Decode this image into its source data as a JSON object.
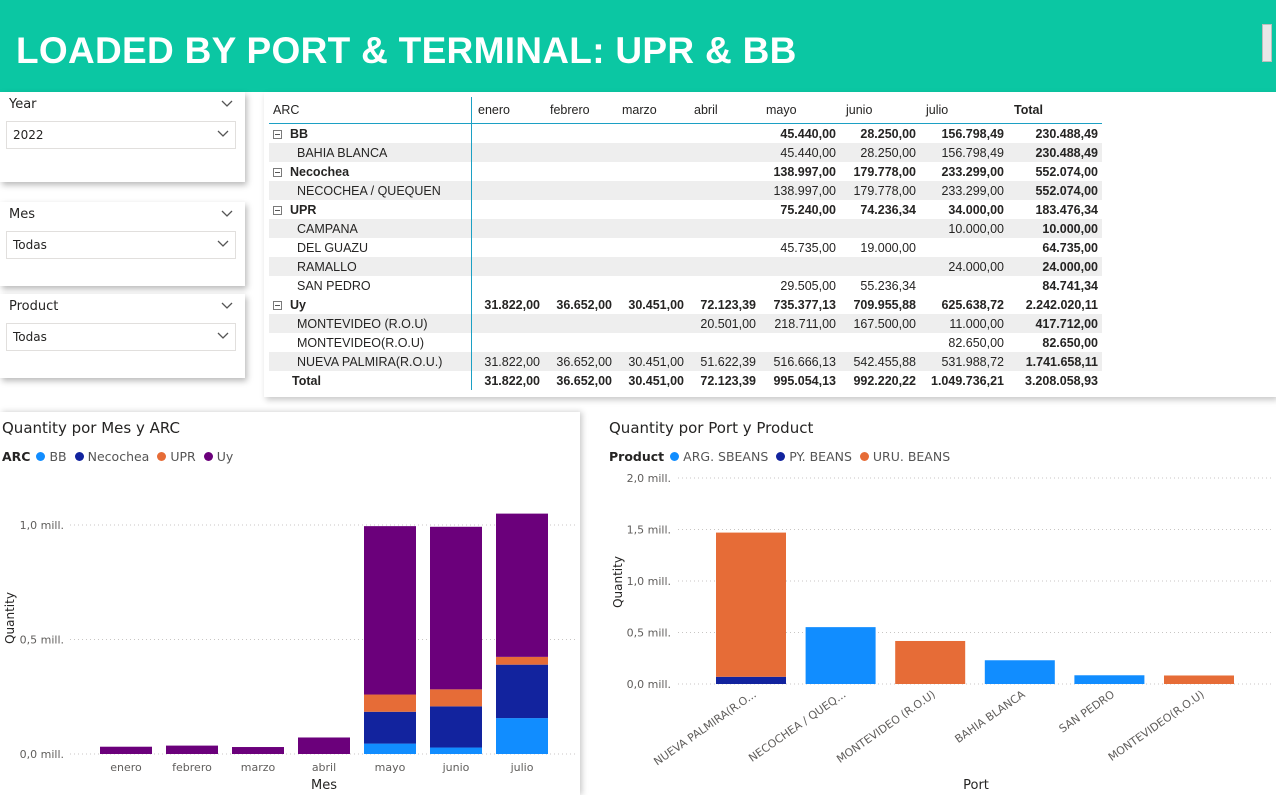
{
  "header": {
    "title": "LOADED BY PORT & TERMINAL: UPR & BB"
  },
  "slicers": {
    "year": {
      "label": "Year",
      "value": "2022"
    },
    "mes": {
      "label": "Mes",
      "value": "Todas"
    },
    "product": {
      "label": "Product",
      "value": "Todas"
    }
  },
  "matrix": {
    "columns": [
      "ARC",
      "enero",
      "febrero",
      "marzo",
      "abril",
      "mayo",
      "junio",
      "julio",
      "Total"
    ],
    "rows": [
      {
        "type": "group",
        "label": "BB",
        "values": [
          "",
          "",
          "",
          "",
          "45.440,00",
          "28.250,00",
          "156.798,49",
          "230.488,49"
        ]
      },
      {
        "type": "detail",
        "label": "BAHIA BLANCA",
        "values": [
          "",
          "",
          "",
          "",
          "45.440,00",
          "28.250,00",
          "156.798,49",
          "230.488,49"
        ]
      },
      {
        "type": "group",
        "label": "Necochea",
        "values": [
          "",
          "",
          "",
          "",
          "138.997,00",
          "179.778,00",
          "233.299,00",
          "552.074,00"
        ]
      },
      {
        "type": "detail",
        "label": "NECOCHEA / QUEQUEN",
        "values": [
          "",
          "",
          "",
          "",
          "138.997,00",
          "179.778,00",
          "233.299,00",
          "552.074,00"
        ]
      },
      {
        "type": "group",
        "label": "UPR",
        "values": [
          "",
          "",
          "",
          "",
          "75.240,00",
          "74.236,34",
          "34.000,00",
          "183.476,34"
        ]
      },
      {
        "type": "detail",
        "label": "CAMPANA",
        "values": [
          "",
          "",
          "",
          "",
          "",
          "",
          "10.000,00",
          "10.000,00"
        ]
      },
      {
        "type": "detail",
        "label": "DEL GUAZU",
        "values": [
          "",
          "",
          "",
          "",
          "45.735,00",
          "19.000,00",
          "",
          "64.735,00"
        ]
      },
      {
        "type": "detail",
        "label": "RAMALLO",
        "values": [
          "",
          "",
          "",
          "",
          "",
          "",
          "24.000,00",
          "24.000,00"
        ]
      },
      {
        "type": "detail",
        "label": "SAN PEDRO",
        "values": [
          "",
          "",
          "",
          "",
          "29.505,00",
          "55.236,34",
          "",
          "84.741,34"
        ]
      },
      {
        "type": "group",
        "label": "Uy",
        "values": [
          "31.822,00",
          "36.652,00",
          "30.451,00",
          "72.123,39",
          "735.377,13",
          "709.955,88",
          "625.638,72",
          "2.242.020,11"
        ]
      },
      {
        "type": "detail",
        "label": "MONTEVIDEO (R.O.U)",
        "values": [
          "",
          "",
          "",
          "20.501,00",
          "218.711,00",
          "167.500,00",
          "11.000,00",
          "417.712,00"
        ]
      },
      {
        "type": "detail",
        "label": "MONTEVIDEO(R.O.U)",
        "values": [
          "",
          "",
          "",
          "",
          "",
          "",
          "82.650,00",
          "82.650,00"
        ]
      },
      {
        "type": "detail",
        "label": "NUEVA PALMIRA(R.O.U.)",
        "values": [
          "31.822,00",
          "36.652,00",
          "30.451,00",
          "51.622,39",
          "516.666,13",
          "542.455,88",
          "531.988,72",
          "1.741.658,11"
        ]
      },
      {
        "type": "total",
        "label": "Total",
        "values": [
          "31.822,00",
          "36.652,00",
          "30.451,00",
          "72.123,39",
          "995.054,13",
          "992.220,22",
          "1.049.736,21",
          "3.208.058,93"
        ]
      }
    ]
  },
  "chart_data": [
    {
      "type": "bar",
      "stacked": true,
      "title": "Quantity por Mes y ARC",
      "legend_title": "ARC",
      "legend_position": "top-left",
      "xlabel": "Mes",
      "ylabel": "Quantity",
      "categories": [
        "enero",
        "febrero",
        "marzo",
        "abril",
        "mayo",
        "junio",
        "julio"
      ],
      "yticks": [
        {
          "value": 0,
          "label": "0,0 mill."
        },
        {
          "value": 500000,
          "label": "0,5 mill."
        },
        {
          "value": 1000000,
          "label": "1,0 mill."
        }
      ],
      "ylim": [
        0,
        1150000
      ],
      "grid": true,
      "series": [
        {
          "name": "BB",
          "color": "#118dff",
          "values": [
            0,
            0,
            0,
            0,
            45440,
            28250,
            156798.49
          ]
        },
        {
          "name": "Necochea",
          "color": "#12239e",
          "values": [
            0,
            0,
            0,
            0,
            138997,
            179778,
            233299
          ]
        },
        {
          "name": "UPR",
          "color": "#e66c37",
          "values": [
            0,
            0,
            0,
            0,
            75240,
            74236.34,
            34000
          ]
        },
        {
          "name": "Uy",
          "color": "#6b007b",
          "values": [
            31822,
            36652,
            30451,
            72123.39,
            735377.13,
            709955.88,
            625638.72
          ]
        }
      ]
    },
    {
      "type": "bar",
      "stacked": true,
      "title": "Quantity por Port y Product",
      "legend_title": "Product",
      "legend_position": "top-left",
      "xlabel": "Port",
      "ylabel": "Quantity",
      "categories": [
        "NUEVA PALMIRA(R.O...",
        "NECOCHEA / QUEQ...",
        "MONTEVIDEO (R.O.U)",
        "BAHIA BLANCA",
        "SAN PEDRO",
        "MONTEVIDEO(R.O.U)"
      ],
      "yticks": [
        {
          "value": 0,
          "label": "0,0 mill."
        },
        {
          "value": 500000,
          "label": "0,5 mill."
        },
        {
          "value": 1000000,
          "label": "1,0 mill."
        },
        {
          "value": 1500000,
          "label": "1,5 mill."
        },
        {
          "value": 2000000,
          "label": "2,0 mill."
        }
      ],
      "ylim": [
        0,
        2000000
      ],
      "grid": true,
      "series": [
        {
          "name": "ARG. SBEANS",
          "color": "#118dff",
          "values": [
            0,
            552074,
            0,
            230488.49,
            84741.34,
            0
          ]
        },
        {
          "name": "PY. BEANS",
          "color": "#12239e",
          "values": [
            70000,
            0,
            0,
            0,
            0,
            0
          ]
        },
        {
          "name": "URU. BEANS",
          "color": "#e66c37",
          "values": [
            1400000,
            0,
            417712,
            0,
            0,
            82650
          ]
        }
      ]
    }
  ]
}
